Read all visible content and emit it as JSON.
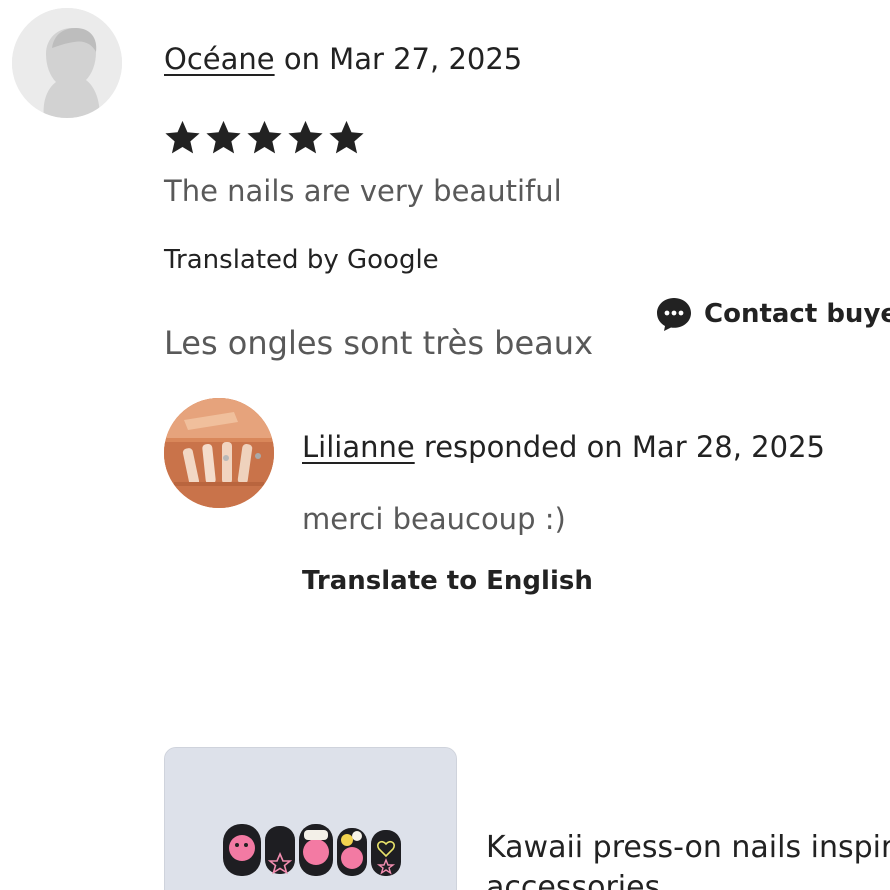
{
  "review": {
    "reviewer_name": "Océane",
    "date_text": " on Mar 27, 2025",
    "rating": 5,
    "text_english": "The nails are very beautiful",
    "translated_by": "Translated by Google",
    "text_original": "Les ongles sont très beaux"
  },
  "actions": {
    "contact_buyer_label": "Contact buyer"
  },
  "response": {
    "seller_name": "Lilianne",
    "date_text": " responded on Mar 28, 2025",
    "text": "merci beaucoup :)",
    "translate_label": "Translate to English"
  },
  "product": {
    "title": "Kawaii press-on nails inspired accessories"
  },
  "icons": {
    "reviewer_avatar": "person-silhouette-icon",
    "star": "star-icon",
    "contact": "chat-bubble-icon"
  },
  "colors": {
    "text_primary": "#222222",
    "text_secondary": "#595959",
    "avatar_bg": "#e9e9e9",
    "product_bg": "#dfe3ec"
  }
}
